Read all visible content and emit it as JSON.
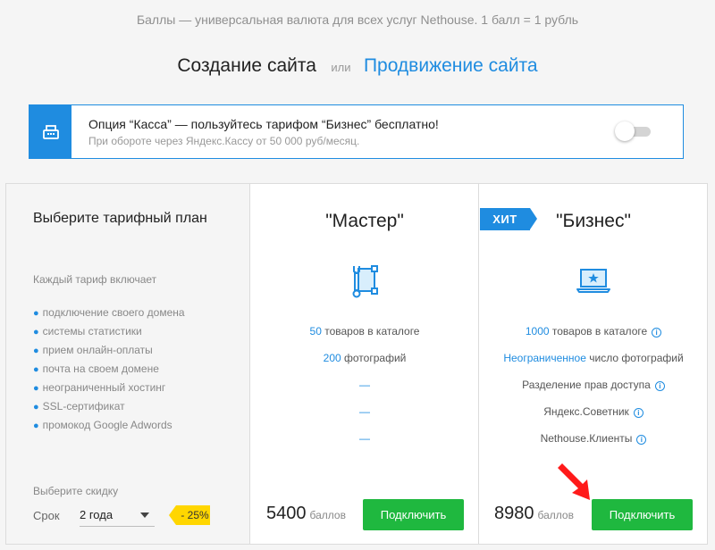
{
  "top_note": "Баллы — универсальная валюта для всех услуг Nethouse. 1 балл = 1 рубль",
  "service_switch": {
    "create": "Создание сайта",
    "or": "или",
    "promo": "Продвижение сайта"
  },
  "kassa": {
    "icon": "cash-register-icon",
    "title": "Опция “Касса” — пользуйтесь тарифом “Бизнес” бесплатно!",
    "subtitle": "При обороте через Яндекс.Кассу от 50 000 руб/месяц.",
    "toggle_on": false
  },
  "left": {
    "heading": "Выберите тарифный план",
    "includes": "Каждый тариф включает",
    "features": [
      "подключение своего домена",
      "системы статистики",
      "прием онлайн-оплаты",
      "почта на своем домене",
      "неограниченный хостинг",
      "SSL-сертификат",
      "промокод Google Adwords"
    ],
    "discount_label": "Выберите скидку",
    "term_label": "Срок",
    "term_value": "2 года",
    "discount_badge": "- 25%"
  },
  "master": {
    "title": "\"Мастер\"",
    "icon": "wrench-frame-icon",
    "products_count": "50",
    "products_text": " товаров в каталоге",
    "photos_count": "200",
    "photos_text": " фотографий",
    "dash": "—",
    "price": "5400",
    "unit": "баллов",
    "button": "Подключить"
  },
  "business": {
    "badge": "ХИТ",
    "title": "\"Бизнес\"",
    "icon": "laptop-star-icon",
    "products_count": "1000",
    "products_text": " товаров в каталоге",
    "photos_hl": "Неограниченное",
    "photos_text": " число фотографий",
    "access": "Разделение прав доступа",
    "advisor": "Яндекс.Советник",
    "clients": "Nethouse.Клиенты",
    "price": "8980",
    "unit": "баллов",
    "button": "Подключить"
  },
  "colors": {
    "accent": "#1f8ce0",
    "button": "#1fb83f",
    "badge": "#ffd600",
    "arrow": "#ff1a1a"
  }
}
